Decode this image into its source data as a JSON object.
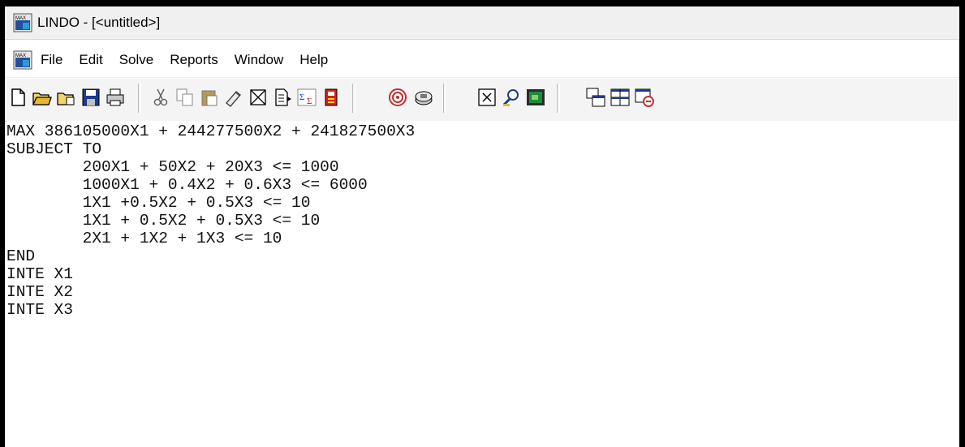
{
  "window": {
    "title": "LINDO - [<untitled>]"
  },
  "menubar": {
    "items": [
      "File",
      "Edit",
      "Solve",
      "Reports",
      "Window",
      "Help"
    ]
  },
  "toolbar": {
    "buttons": [
      "new-icon",
      "open-icon",
      "open-file-icon",
      "save-icon",
      "print-icon",
      "cut-icon",
      "copy-icon",
      "paste-icon",
      "clear-icon",
      "delete-icon",
      "find-icon",
      "sum-icon",
      "report-icon",
      "target-icon",
      "disk-icon",
      "cancel-icon",
      "zoom-icon",
      "picture-icon",
      "cascade-icon",
      "tile-icon",
      "arrange-icon"
    ]
  },
  "editor": {
    "lines": [
      "MAX 386105000X1 + 244277500X2 + 241827500X3",
      "SUBJECT TO",
      "        200X1 + 50X2 + 20X3 <= 1000",
      "        1000X1 + 0.4X2 + 0.6X3 <= 6000",
      "        1X1 +0.5X2 + 0.5X3 <= 10",
      "        1X1 + 0.5X2 + 0.5X3 <= 10",
      "        2X1 + 1X2 + 1X3 <= 10",
      "END",
      "INTE X1",
      "INTE X2",
      "INTE X3"
    ]
  }
}
